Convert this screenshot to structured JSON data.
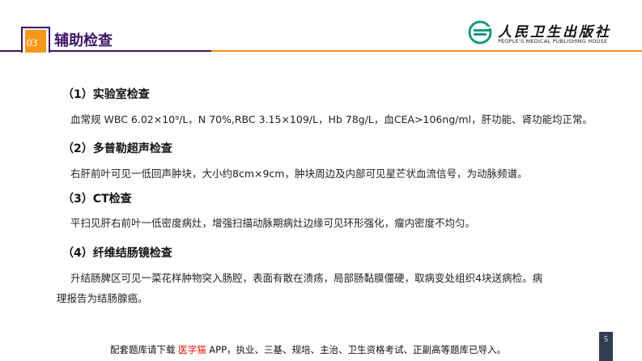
{
  "header": {
    "section_number": "03",
    "title": "辅助检查",
    "colors": {
      "purple": "#3b1466",
      "orange": "#f39416"
    }
  },
  "logo": {
    "name_cn": "人民卫生出版社",
    "name_en": "PEOPLE'S MEDICAL PUBLISHING HOUSE",
    "icon": "pmph-logo-icon"
  },
  "sections": [
    {
      "heading": "（1）实验室检查",
      "lines": [
        "血常规 WBC 6.02×10⁹/L，N 70%,RBC 3.15×109/L，Hb 78g/L，血CEA>106ng/ml，肝功能、肾功能均正常。"
      ]
    },
    {
      "heading": "（2）多普勒超声检查",
      "lines": [
        "右肝前叶可见一低回声肿块，大小约8cm×9cm，肿块周边及内部可见星芒状血流信号，为动脉频谱。"
      ]
    },
    {
      "heading": "（3）CT检查",
      "lines": [
        "平扫见肝右前叶一低密度病灶，增强扫描动脉期病灶边缘可见环形强化，瘤内密度不均匀。"
      ]
    },
    {
      "heading": "（4）纤维结肠镜检查",
      "lines": [
        "升结肠脾区可见一菜花样肿物突入肠腔，表面有散在溃疡，局部肠黏膜僵硬，取病变处组织4块送病检。病",
        "理报告为结肠腺癌。"
      ]
    }
  ],
  "footer": {
    "prefix": "配套题库请下载 ",
    "app_name": "医学猫",
    "suffix": " APP，执业、三基、规培、主治、卫生资格考试、正副高等题库已导入。",
    "app_color": "#f01010"
  },
  "page_number": "5"
}
